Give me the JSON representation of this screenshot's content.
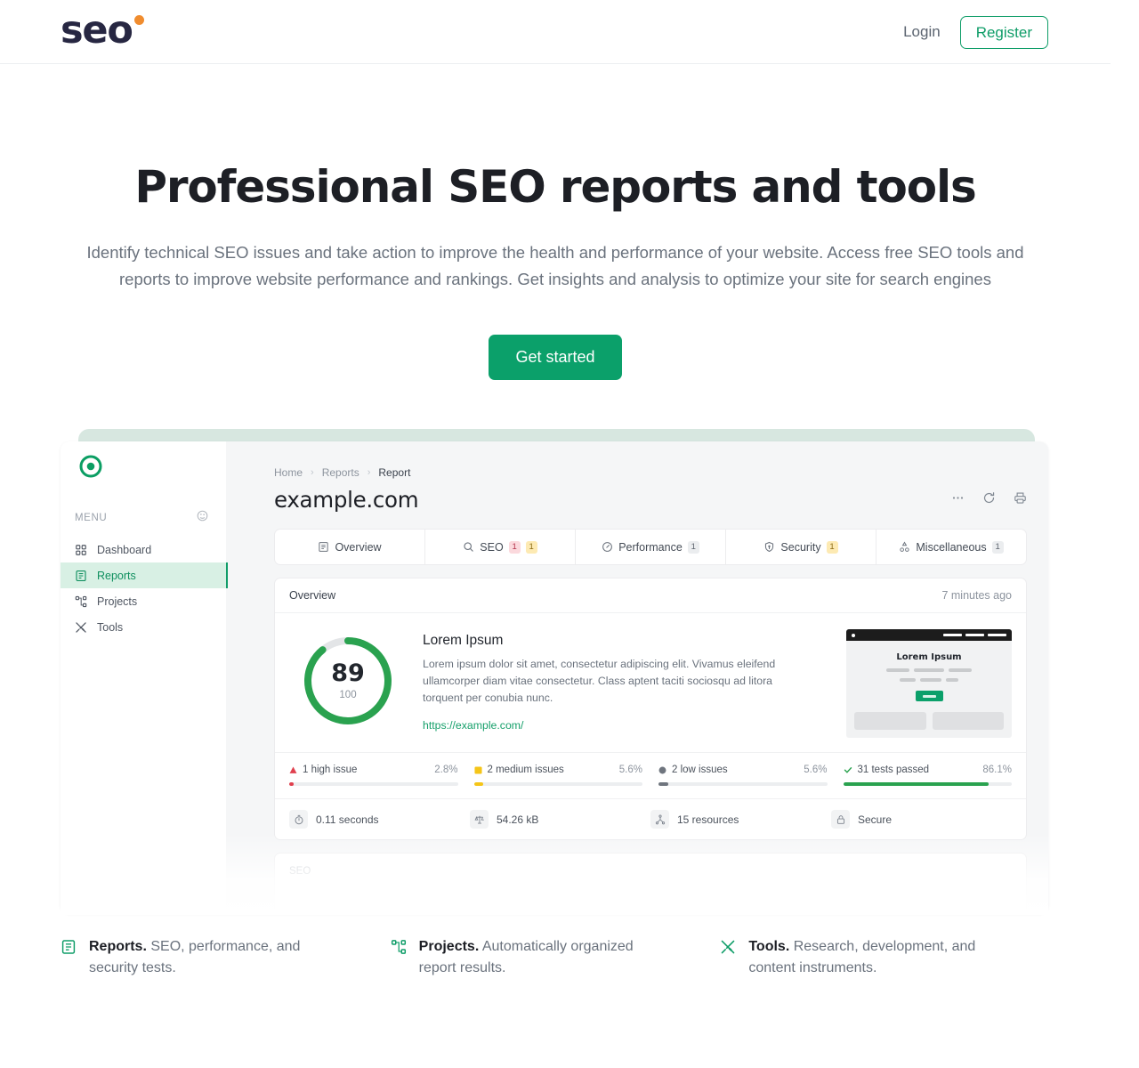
{
  "brand": {
    "name": "seo",
    "dot_color": "#f08c2e",
    "accent": "#0f9d68"
  },
  "nav": {
    "login": "Login",
    "register": "Register"
  },
  "hero": {
    "title": "Professional SEO reports and tools",
    "subtitle": "Identify technical SEO issues and take action to improve the health and performance of your website. Access free SEO tools and reports to improve website performance and rankings. Get insights and analysis to optimize your site for search engines",
    "cta": "Get started"
  },
  "mockup": {
    "sidebar": {
      "menu_label": "MENU",
      "items": [
        {
          "label": "Dashboard",
          "icon": "grid-icon",
          "active": false
        },
        {
          "label": "Reports",
          "icon": "report-icon",
          "active": true
        },
        {
          "label": "Projects",
          "icon": "projects-icon",
          "active": false
        },
        {
          "label": "Tools",
          "icon": "tools-icon",
          "active": false
        }
      ]
    },
    "breadcrumb": {
      "home": "Home",
      "reports": "Reports",
      "current": "Report"
    },
    "title": "example.com",
    "tabs": [
      {
        "label": "Overview",
        "icon": "list-icon",
        "badges": []
      },
      {
        "label": "SEO",
        "icon": "search-icon",
        "badges": [
          {
            "value": "1",
            "tone": "red"
          },
          {
            "value": "1",
            "tone": "yellow"
          }
        ]
      },
      {
        "label": "Performance",
        "icon": "gauge-icon",
        "badges": [
          {
            "value": "1",
            "tone": "grey"
          }
        ]
      },
      {
        "label": "Security",
        "icon": "shield-icon",
        "badges": [
          {
            "value": "1",
            "tone": "yellow"
          }
        ]
      },
      {
        "label": "Miscellaneous",
        "icon": "misc-icon",
        "badges": [
          {
            "value": "1",
            "tone": "grey"
          }
        ]
      }
    ],
    "overview": {
      "card_title": "Overview",
      "updated": "7 minutes ago",
      "score": "89",
      "score_max": "100",
      "score_percent": 89,
      "heading": "Lorem Ipsum",
      "body": "Lorem ipsum dolor sit amet, consectetur adipiscing elit. Vivamus eleifend ullamcorper diam vitae consectetur. Class aptent taciti sociosqu ad litora torquent per conubia nunc.",
      "link": "https://example.com/",
      "thumb_heading": "Lorem Ipsum"
    },
    "issues": [
      {
        "label": "1 high issue",
        "pct": "2.8%",
        "fill": 2.8,
        "color": "#e0404e",
        "marker": "triangle"
      },
      {
        "label": "2 medium issues",
        "pct": "5.6%",
        "fill": 5.6,
        "color": "#f5c518",
        "marker": "square"
      },
      {
        "label": "2 low issues",
        "pct": "5.6%",
        "fill": 5.6,
        "color": "#6f757e",
        "marker": "circle"
      },
      {
        "label": "31 tests passed",
        "pct": "86.1%",
        "fill": 86.1,
        "color": "#2aa24f",
        "marker": "check"
      }
    ],
    "stats": [
      {
        "label": "0.11 seconds",
        "icon": "timer-icon"
      },
      {
        "label": "54.26 kB",
        "icon": "weight-icon"
      },
      {
        "label": "15 resources",
        "icon": "resources-icon"
      },
      {
        "label": "Secure",
        "icon": "lock-icon"
      }
    ],
    "next_section": "SEO",
    "actions": [
      {
        "name": "more-icon",
        "label": "More"
      },
      {
        "name": "refresh-icon",
        "label": "Refresh"
      },
      {
        "name": "print-icon",
        "label": "Print"
      }
    ]
  },
  "features": [
    {
      "icon": "report-icon",
      "title": "Reports.",
      "text": " SEO, performance, and security tests."
    },
    {
      "icon": "projects-icon",
      "title": "Projects.",
      "text": " Automatically organized report results."
    },
    {
      "icon": "tools-icon",
      "title": "Tools.",
      "text": " Research, development, and content instruments."
    }
  ]
}
